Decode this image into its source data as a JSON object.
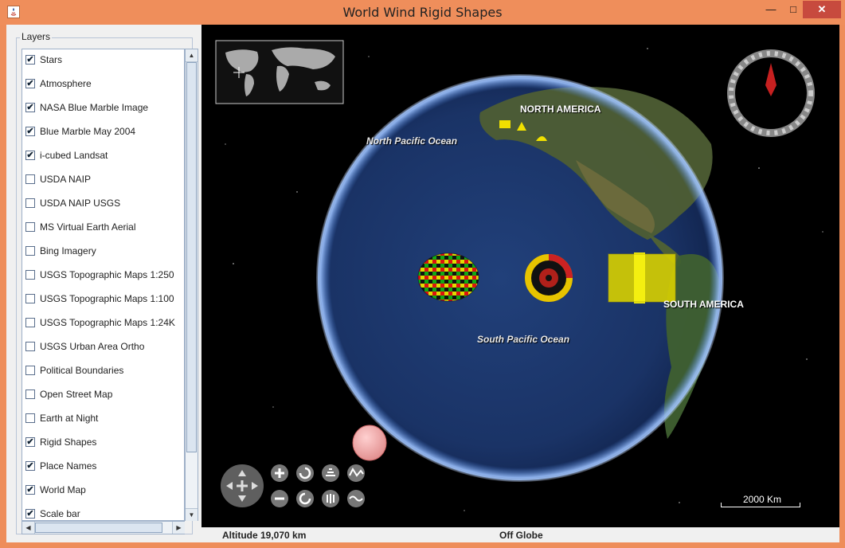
{
  "window": {
    "title": "World Wind Rigid Shapes",
    "min_symbol": "—",
    "max_symbol": "□",
    "close_symbol": "✕"
  },
  "layers_panel": {
    "legend": "Layers",
    "items": [
      {
        "label": "Stars",
        "checked": true
      },
      {
        "label": "Atmosphere",
        "checked": true
      },
      {
        "label": "NASA Blue Marble Image",
        "checked": true
      },
      {
        "label": "Blue Marble May 2004",
        "checked": true
      },
      {
        "label": "i-cubed Landsat",
        "checked": true
      },
      {
        "label": "USDA NAIP",
        "checked": false
      },
      {
        "label": "USDA NAIP USGS",
        "checked": false
      },
      {
        "label": "MS Virtual Earth Aerial",
        "checked": false
      },
      {
        "label": "Bing Imagery",
        "checked": false
      },
      {
        "label": "USGS Topographic Maps 1:250",
        "checked": false
      },
      {
        "label": "USGS Topographic Maps 1:100",
        "checked": false
      },
      {
        "label": "USGS Topographic Maps 1:24K",
        "checked": false
      },
      {
        "label": "USGS Urban Area Ortho",
        "checked": false
      },
      {
        "label": "Political Boundaries",
        "checked": false
      },
      {
        "label": "Open Street Map",
        "checked": false
      },
      {
        "label": "Earth at Night",
        "checked": false
      },
      {
        "label": "Rigid Shapes",
        "checked": true
      },
      {
        "label": "Place Names",
        "checked": true
      },
      {
        "label": "World Map",
        "checked": true
      },
      {
        "label": "Scale bar",
        "checked": true
      }
    ]
  },
  "map": {
    "labels": {
      "north_america": "NORTH AMERICA",
      "south_america": "SOUTH AMERICA",
      "north_pacific": "North Pacific Ocean",
      "south_pacific": "South Pacific Ocean"
    },
    "scale_bar": "2000 Km"
  },
  "status": {
    "altitude": "Altitude  19,070 km",
    "position": "Off Globe"
  },
  "icons": [
    "java-icon",
    "compass-icon",
    "pan-control-icon",
    "zoom-in-icon",
    "zoom-out-icon",
    "rotate-left-icon",
    "rotate-right-icon",
    "tilt-up-icon",
    "tilt-down-icon",
    "vertical-exaggeration-up-icon",
    "vertical-exaggeration-down-icon"
  ],
  "colors": {
    "titlebar": "#ef8e5b",
    "close_button": "#c74a3e",
    "space": "#000000",
    "ocean": "#1c3a6e",
    "shape_yellow": "#f0e000"
  }
}
